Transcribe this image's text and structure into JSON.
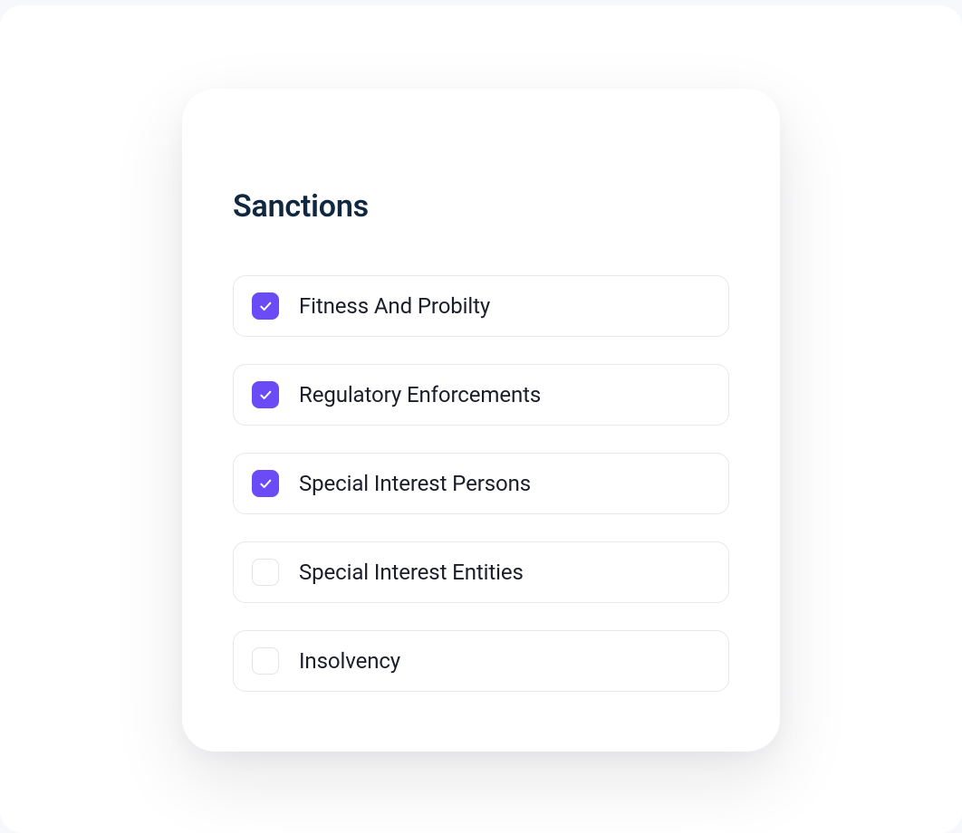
{
  "card": {
    "title": "Sanctions",
    "options": [
      {
        "label": "Fitness And Probilty",
        "checked": true
      },
      {
        "label": "Regulatory Enforcements",
        "checked": true
      },
      {
        "label": "Special Interest Persons",
        "checked": true
      },
      {
        "label": "Special Interest Entities",
        "checked": false
      },
      {
        "label": "Insolvency",
        "checked": false
      }
    ]
  }
}
